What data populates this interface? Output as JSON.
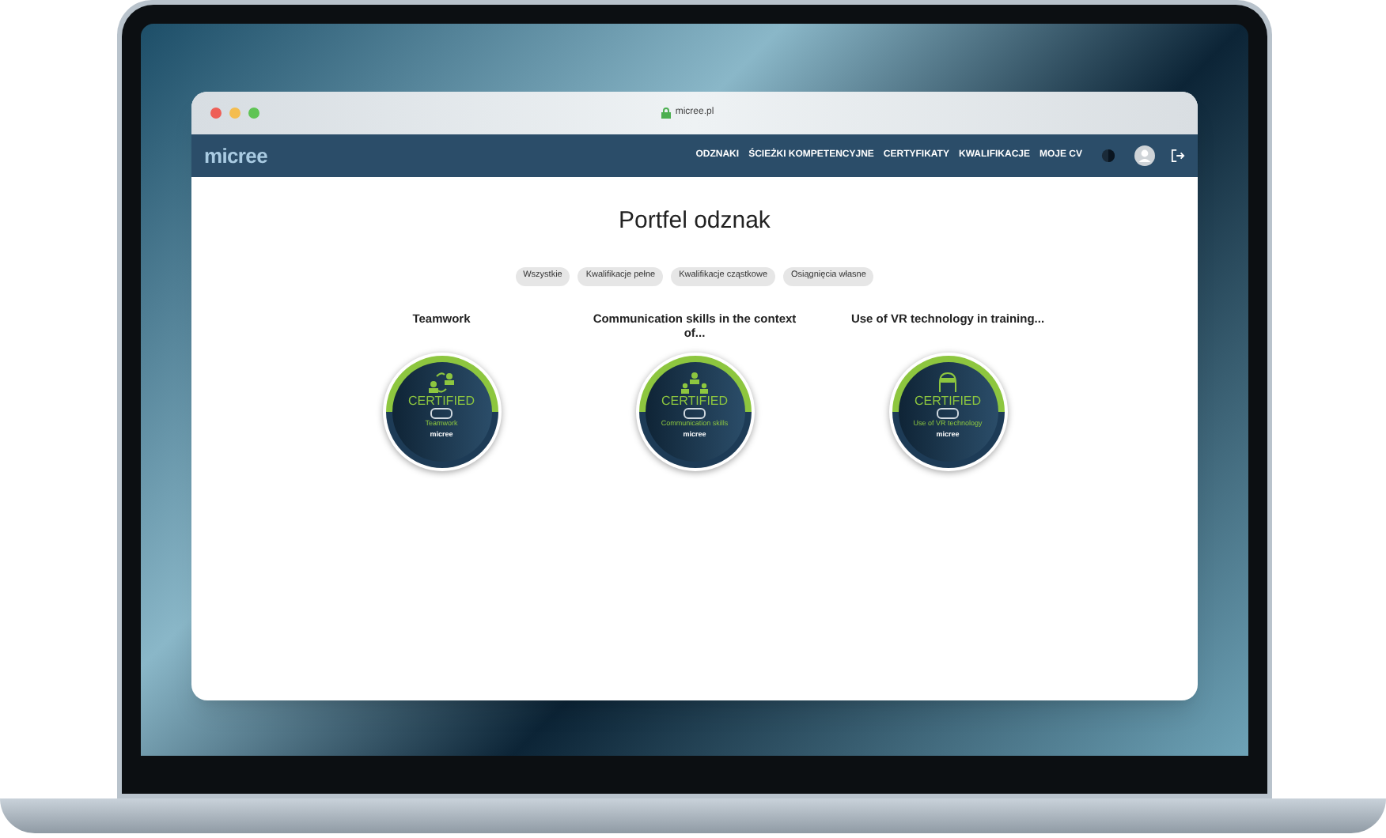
{
  "browser": {
    "url": "micree.pl"
  },
  "navbar": {
    "logo": "micree",
    "links": [
      {
        "label": "ODZNAKI"
      },
      {
        "label": "ŚCIEŻKI KOMPETENCYJNE"
      },
      {
        "label": "CERTYFIKATY"
      },
      {
        "label": "KWALIFIKACJE"
      },
      {
        "label": "MOJE CV"
      }
    ]
  },
  "page": {
    "title": "Portfel odznak",
    "filters": [
      {
        "label": "Wszystkie",
        "selected": false
      },
      {
        "label": "Kwalifikacje pełne",
        "selected": false
      },
      {
        "label": "Kwalifikacje cząstkowe",
        "selected": false
      },
      {
        "label": "Osiągnięcia własne",
        "selected": false
      }
    ],
    "badges": [
      {
        "title": "Teamwork",
        "seal": "CERTIFIED",
        "name": "Teamwork",
        "brand": "micree",
        "kind": "people"
      },
      {
        "title": "Communication skills in the context of...",
        "seal": "CERTIFIED",
        "name": "Communication skills",
        "brand": "micree",
        "kind": "group"
      },
      {
        "title": "Use of VR technology in training...",
        "seal": "CERTIFIED",
        "name": "Use of VR technology",
        "brand": "micree",
        "kind": "vr"
      }
    ]
  }
}
